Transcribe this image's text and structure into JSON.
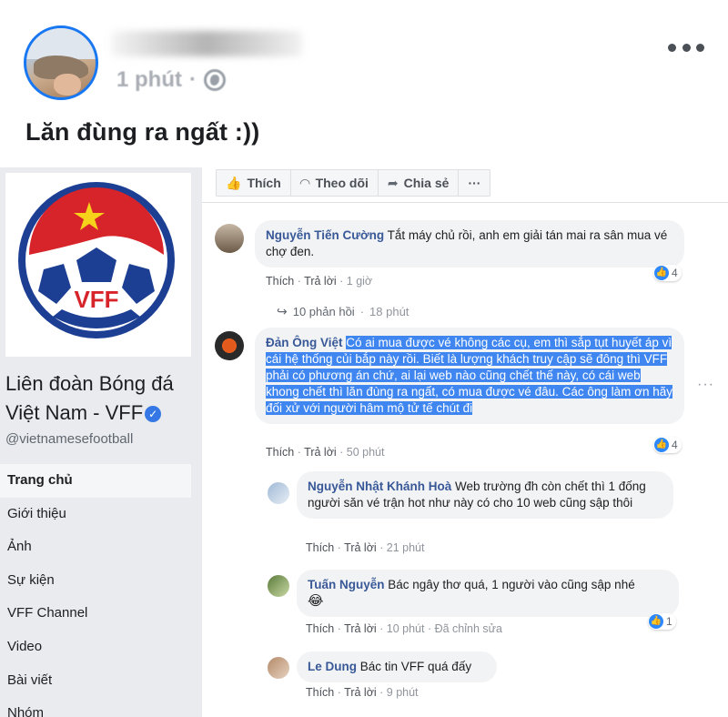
{
  "post": {
    "time": "1 phút",
    "dot": "·",
    "text": "Lăn đùng ra ngất :))"
  },
  "sidebar": {
    "logo_text": "VFF",
    "page_name": "Liên đoàn Bóng đá Việt Nam - VFF",
    "handle": "@vietnamesefootball",
    "nav": [
      "Trang chủ",
      "Giới thiệu",
      "Ảnh",
      "Sự kiện",
      "VFF Channel",
      "Video",
      "Bài viết",
      "Nhóm"
    ]
  },
  "actions": {
    "like": "Thích",
    "follow": "Theo dõi",
    "share": "Chia sẻ",
    "more": "···"
  },
  "comments": [
    {
      "name": "Nguyễn Tiến Cường",
      "text": "Tắt máy chủ rồi, anh em giải tán mai ra sân mua vé chợ đen.",
      "like": "Thích",
      "reply": "Trả lời",
      "time": "1 giờ",
      "reactions": "4",
      "replies": "10 phản hồi",
      "replies_time": "18 phút"
    },
    {
      "name": "Đản Ông Việt",
      "text": "Có ai mua được vé không các cụ, em thì sắp tụt huyết áp vì cái hệ thống củi bắp này rồi. Biết là lượng khách truy cập sẽ đông thì VFF phải có phương án chứ, ai lại web nào cũng chết thế này, có cái web khong chết thì lăn đùng ra ngất, có mua được vé đâu. Các ông làm ơn hãy đối xử với người hâm mộ tử tế chút đi",
      "like": "Thích",
      "reply": "Trả lời",
      "time": "50 phút",
      "reactions": "4"
    },
    {
      "name": "Nguyễn Nhật Khánh Hoà",
      "text": "Web trường đh còn chết thì 1 đống người săn vé trận hot như này có cho 10 web cũng sập thôi",
      "like": "Thích",
      "reply": "Trả lời",
      "time": "21 phút"
    },
    {
      "name": "Tuấn Nguyễn",
      "text": "Bác ngây thơ quá, 1 người vào cũng sập nhé",
      "emoji": "😂",
      "like": "Thích",
      "reply": "Trả lời",
      "time": "10 phút",
      "edited": "Đã chỉnh sửa",
      "reactions": "1"
    },
    {
      "name": "Le Dung",
      "text": "Bác tin VFF quá đấy",
      "like": "Thích",
      "reply": "Trả lời",
      "time": "9 phút"
    }
  ],
  "colors": {
    "link_blue": "#385898",
    "highlight": "#3f86f0",
    "vff_red": "#d7242a",
    "vff_blue": "#1c3f94"
  }
}
